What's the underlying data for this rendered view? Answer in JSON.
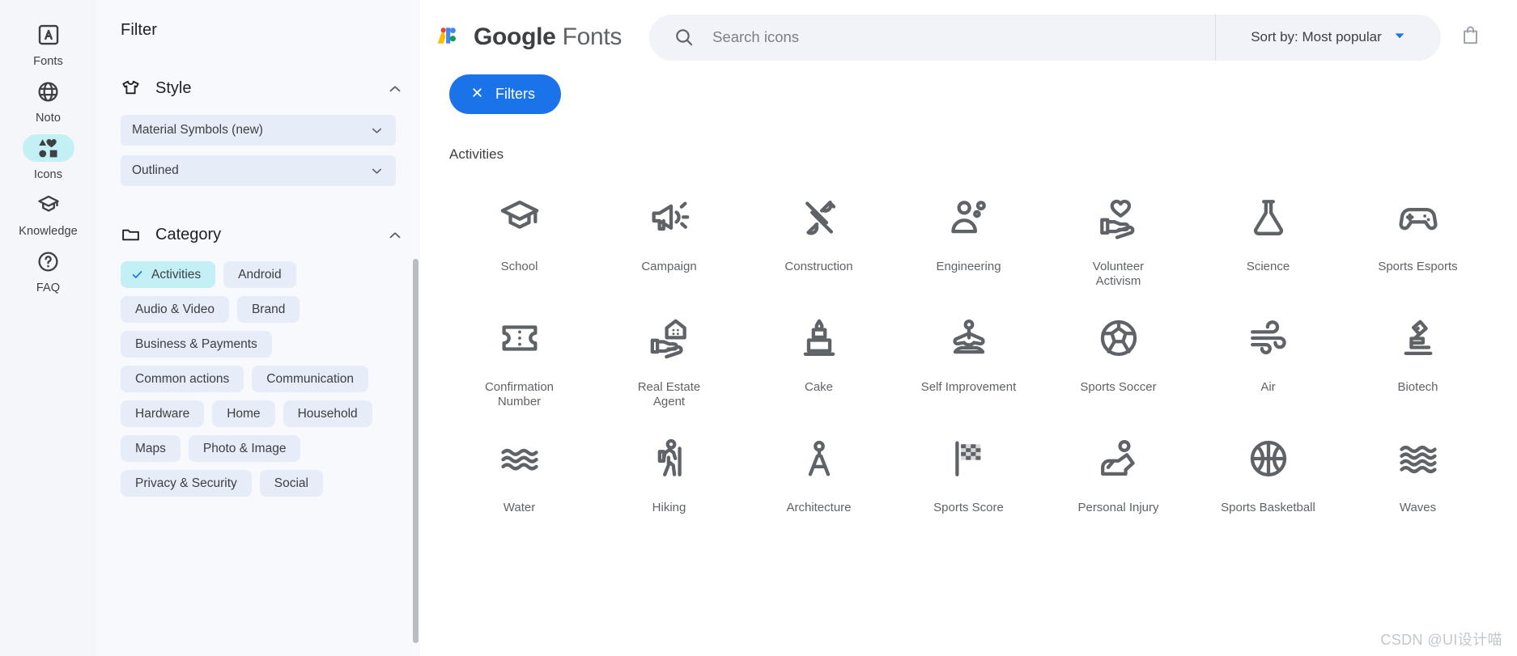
{
  "rail": {
    "items": [
      {
        "label": "Fonts",
        "icon": "font-a-icon",
        "active": false
      },
      {
        "label": "Noto",
        "icon": "globe-icon",
        "active": false
      },
      {
        "label": "Icons",
        "icon": "shapes-icon",
        "active": true
      },
      {
        "label": "Knowledge",
        "icon": "graduation-cap-icon",
        "active": false
      },
      {
        "label": "FAQ",
        "icon": "help-circle-icon",
        "active": false
      }
    ]
  },
  "filter": {
    "title": "Filter",
    "style": {
      "label": "Style",
      "icon": "tshirt-icon",
      "collapse_icon": "chevron-up-icon",
      "selects": [
        {
          "value": "Material Symbols (new)",
          "icon": "chevron-down-icon"
        },
        {
          "value": "Outlined",
          "icon": "chevron-down-icon"
        }
      ]
    },
    "category": {
      "label": "Category",
      "icon": "folder-icon",
      "collapse_icon": "chevron-up-icon",
      "chips": [
        {
          "label": "Activities",
          "selected": true
        },
        {
          "label": "Android",
          "selected": false
        },
        {
          "label": "Audio & Video",
          "selected": false
        },
        {
          "label": "Brand",
          "selected": false
        },
        {
          "label": "Business & Payments",
          "selected": false
        },
        {
          "label": "Common actions",
          "selected": false
        },
        {
          "label": "Communication",
          "selected": false
        },
        {
          "label": "Hardware",
          "selected": false
        },
        {
          "label": "Home",
          "selected": false
        },
        {
          "label": "Household",
          "selected": false
        },
        {
          "label": "Maps",
          "selected": false
        },
        {
          "label": "Photo & Image",
          "selected": false
        },
        {
          "label": "Privacy & Security",
          "selected": false
        },
        {
          "label": "Social",
          "selected": false
        }
      ]
    }
  },
  "header": {
    "brand_google": "Google",
    "brand_fonts": "Fonts",
    "brand_icon": "google-fonts-logo",
    "search": {
      "placeholder": "Search icons",
      "value": "",
      "icon": "search-icon"
    },
    "sort": {
      "label": "Sort by: Most popular",
      "icon": "chevron-down-icon"
    },
    "cart": {
      "icon": "shopping-bag-icon"
    }
  },
  "toolbar": {
    "filters_label": "Filters",
    "filters_icon": "close-icon"
  },
  "content": {
    "section_label": "Activities",
    "icons": [
      {
        "label": "School",
        "name": "school-icon"
      },
      {
        "label": "Campaign",
        "name": "campaign-icon"
      },
      {
        "label": "Construction",
        "name": "construction-icon"
      },
      {
        "label": "Engineering",
        "name": "engineering-icon"
      },
      {
        "label": "Volunteer Activism",
        "name": "volunteer-activism-icon"
      },
      {
        "label": "Science",
        "name": "science-icon"
      },
      {
        "label": "Sports Esports",
        "name": "sports-esports-icon"
      },
      {
        "label": "Confirmation Number",
        "name": "confirmation-number-icon"
      },
      {
        "label": "Real Estate Agent",
        "name": "real-estate-agent-icon"
      },
      {
        "label": "Cake",
        "name": "cake-icon"
      },
      {
        "label": "Self Improvement",
        "name": "self-improvement-icon"
      },
      {
        "label": "Sports Soccer",
        "name": "sports-soccer-icon"
      },
      {
        "label": "Air",
        "name": "air-icon"
      },
      {
        "label": "Biotech",
        "name": "biotech-icon"
      },
      {
        "label": "Water",
        "name": "water-icon"
      },
      {
        "label": "Hiking",
        "name": "hiking-icon"
      },
      {
        "label": "Architecture",
        "name": "architecture-icon"
      },
      {
        "label": "Sports Score",
        "name": "sports-score-icon"
      },
      {
        "label": "Personal Injury",
        "name": "personal-injury-icon"
      },
      {
        "label": "Sports Basketball",
        "name": "sports-basketball-icon"
      },
      {
        "label": "Waves",
        "name": "waves-icon"
      }
    ]
  },
  "watermark": "CSDN @UI设计喵",
  "colors": {
    "accent": "#1a73e8",
    "selected_chip": "#c2f0f5",
    "chip": "#e6ecf8",
    "panel": "#f8f9fd",
    "rail": "#f4f6fa"
  }
}
